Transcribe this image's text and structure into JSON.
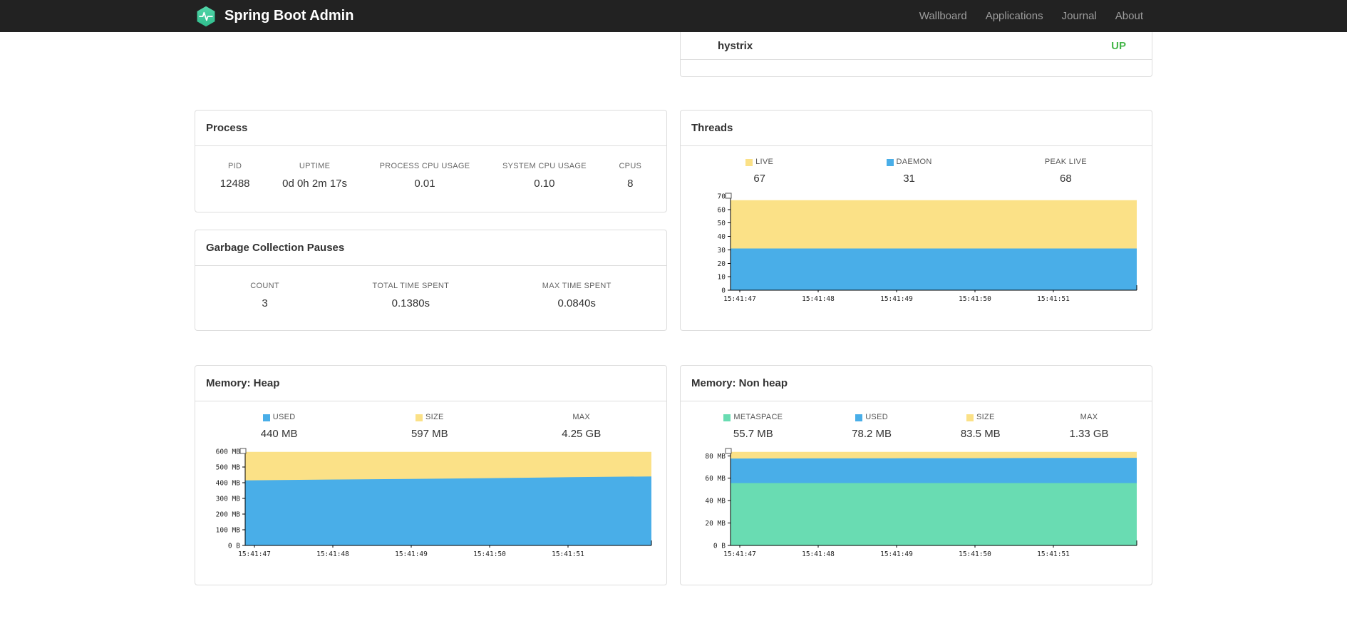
{
  "navbar": {
    "brand": "Spring Boot Admin",
    "links": [
      {
        "label": "Wallboard"
      },
      {
        "label": "Applications"
      },
      {
        "label": "Journal"
      },
      {
        "label": "About"
      }
    ]
  },
  "colors": {
    "navbar_bg": "#222222",
    "logo_teal": "#4ad3a6",
    "logo_teal_dark": "#2fbd8d",
    "up_green": "#44b649",
    "series_yellow": "#fbe187",
    "series_blue": "#49aee8",
    "series_green": "#69dcb2"
  },
  "panels": {
    "health": {
      "rows": [
        {
          "name": "hystrix",
          "status": "UP",
          "status_color": "up_green"
        }
      ]
    },
    "process": {
      "title": "Process",
      "stats": [
        {
          "label": "PID",
          "value": "12488"
        },
        {
          "label": "UPTIME",
          "value": "0d 0h 2m 17s"
        },
        {
          "label": "PROCESS CPU USAGE",
          "value": "0.01"
        },
        {
          "label": "SYSTEM CPU USAGE",
          "value": "0.10"
        },
        {
          "label": "CPUS",
          "value": "8"
        }
      ]
    },
    "gc": {
      "title": "Garbage Collection Pauses",
      "stats": [
        {
          "label": "COUNT",
          "value": "3"
        },
        {
          "label": "TOTAL TIME SPENT",
          "value": "0.1380s"
        },
        {
          "label": "MAX TIME SPENT",
          "value": "0.0840s"
        }
      ]
    },
    "threads": {
      "title": "Threads",
      "legend": [
        {
          "label": "LIVE",
          "color": "series_yellow",
          "value": "67"
        },
        {
          "label": "DAEMON",
          "color": "series_blue",
          "value": "31"
        },
        {
          "label": "PEAK LIVE",
          "color": null,
          "value": "68"
        }
      ]
    },
    "heap": {
      "title": "Memory: Heap",
      "legend": [
        {
          "label": "USED",
          "color": "series_blue",
          "value": "440 MB"
        },
        {
          "label": "SIZE",
          "color": "series_yellow",
          "value": "597 MB"
        },
        {
          "label": "MAX",
          "color": null,
          "value": "4.25 GB"
        }
      ]
    },
    "nonheap": {
      "title": "Memory: Non heap",
      "legend": [
        {
          "label": "METASPACE",
          "color": "series_green",
          "value": "55.7 MB"
        },
        {
          "label": "USED",
          "color": "series_blue",
          "value": "78.2 MB"
        },
        {
          "label": "SIZE",
          "color": "series_yellow",
          "value": "83.5 MB"
        },
        {
          "label": "MAX",
          "color": null,
          "value": "1.33 GB"
        }
      ]
    }
  },
  "chart_data": [
    {
      "id": "threads",
      "type": "area",
      "title": "Threads",
      "y_max": 70,
      "y_ticks": [
        {
          "value": 70,
          "label": "70"
        },
        {
          "value": 60,
          "label": "60"
        },
        {
          "value": 50,
          "label": "50"
        },
        {
          "value": 40,
          "label": "40"
        },
        {
          "value": 30,
          "label": "30"
        },
        {
          "value": 20,
          "label": "20"
        },
        {
          "value": 10,
          "label": "10"
        },
        {
          "value": 0,
          "label": "0"
        }
      ],
      "x": [
        "15:41:47",
        "15:41:48",
        "15:41:49",
        "15:41:50",
        "15:41:51"
      ],
      "series": [
        {
          "name": "LIVE",
          "color": "series_yellow",
          "values": [
            67,
            67,
            67,
            67,
            67,
            67
          ]
        },
        {
          "name": "DAEMON",
          "color": "series_blue",
          "values": [
            31,
            31,
            31,
            31,
            31,
            31
          ]
        }
      ]
    },
    {
      "id": "heap",
      "type": "area",
      "title": "Memory: Heap",
      "unit": "MB",
      "y_max": 600,
      "y_ticks": [
        {
          "value": 600,
          "label": "600 MB"
        },
        {
          "value": 500,
          "label": "500 MB"
        },
        {
          "value": 400,
          "label": "400 MB"
        },
        {
          "value": 300,
          "label": "300 MB"
        },
        {
          "value": 200,
          "label": "200 MB"
        },
        {
          "value": 100,
          "label": "100 MB"
        },
        {
          "value": 0,
          "label": "0 B"
        }
      ],
      "x": [
        "15:41:47",
        "15:41:48",
        "15:41:49",
        "15:41:50",
        "15:41:51"
      ],
      "series": [
        {
          "name": "SIZE",
          "color": "series_yellow",
          "values": [
            597,
            597,
            597,
            597,
            597,
            597
          ]
        },
        {
          "name": "USED",
          "color": "series_blue",
          "values": [
            415,
            420,
            424,
            429,
            435,
            440
          ]
        }
      ]
    },
    {
      "id": "nonheap",
      "type": "area",
      "title": "Memory: Non heap",
      "unit": "MB",
      "y_max": 84,
      "y_ticks": [
        {
          "value": 80,
          "label": "80 MB"
        },
        {
          "value": 60,
          "label": "60 MB"
        },
        {
          "value": 40,
          "label": "40 MB"
        },
        {
          "value": 20,
          "label": "20 MB"
        },
        {
          "value": 0,
          "label": "0 B"
        }
      ],
      "x": [
        "15:41:47",
        "15:41:48",
        "15:41:49",
        "15:41:50",
        "15:41:51"
      ],
      "series": [
        {
          "name": "SIZE",
          "color": "series_yellow",
          "values": [
            83.5,
            83.5,
            83.5,
            83.5,
            83.5,
            83.5
          ]
        },
        {
          "name": "USED",
          "color": "series_blue",
          "values": [
            77.6,
            77.7,
            77.8,
            77.9,
            78.1,
            78.2
          ]
        },
        {
          "name": "METASPACE",
          "color": "series_green",
          "values": [
            55.7,
            55.7,
            55.7,
            55.7,
            55.7,
            55.7
          ]
        }
      ]
    }
  ]
}
